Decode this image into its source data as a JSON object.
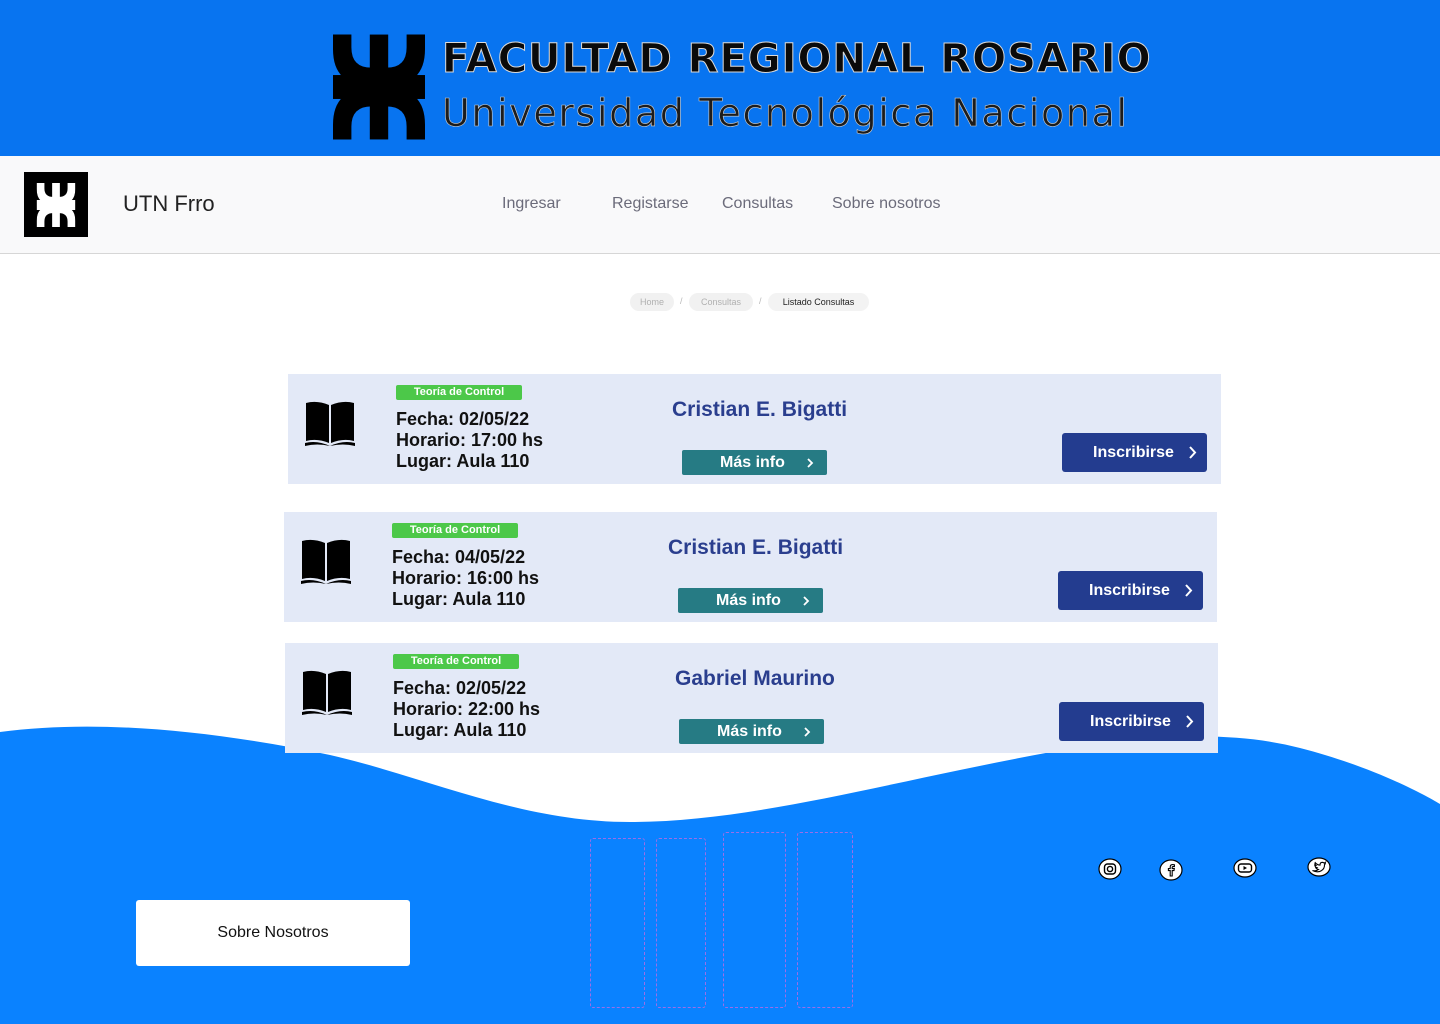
{
  "banner": {
    "title": "FACULTAD REGIONAL ROSARIO",
    "subtitle": "Universidad Tecnológica Nacional",
    "logo_icon": "utn-logo-icon"
  },
  "navbar": {
    "brand": "UTN Frro",
    "logo_icon": "utn-logo-icon",
    "links": [
      "Ingresar",
      "Registarse",
      "Consultas",
      "Sobre nosotros"
    ]
  },
  "breadcrumb": [
    "Home",
    "Consultas",
    "Listado Consultas"
  ],
  "consultas": [
    {
      "subject": "Teoría de Control",
      "fecha": "Fecha: 02/05/22",
      "horario": "Horario: 17:00 hs",
      "lugar": "Lugar: Aula 110",
      "professor": "Cristian E. Bigatti",
      "info_label": "Más info",
      "enroll_label": "Inscribirse"
    },
    {
      "subject": "Teoría de Control",
      "fecha": "Fecha: 04/05/22",
      "horario": "Horario: 16:00 hs",
      "lugar": "Lugar: Aula 110",
      "professor": "Cristian E. Bigatti",
      "info_label": "Más info",
      "enroll_label": "Inscribirse"
    },
    {
      "subject": "Teoría de Control",
      "fecha": "Fecha: 02/05/22",
      "horario": "Horario: 22:00 hs",
      "lugar": "Lugar: Aula 110",
      "professor": "Gabriel Maurino",
      "info_label": "Más info",
      "enroll_label": "Inscribirse"
    }
  ],
  "footer": {
    "about_label": "Sobre Nosotros",
    "social_icons": [
      "instagram-icon",
      "facebook-icon",
      "youtube-icon",
      "twitter-icon"
    ]
  },
  "colors": {
    "banner_blue": "#0874f0",
    "footer_blue": "#0a82ff",
    "card_bg": "#e3e9f7",
    "badge_green": "#4cc849",
    "professor_text": "#2a3e8e",
    "info_button": "#267b84",
    "enroll_button": "#233c8f"
  }
}
